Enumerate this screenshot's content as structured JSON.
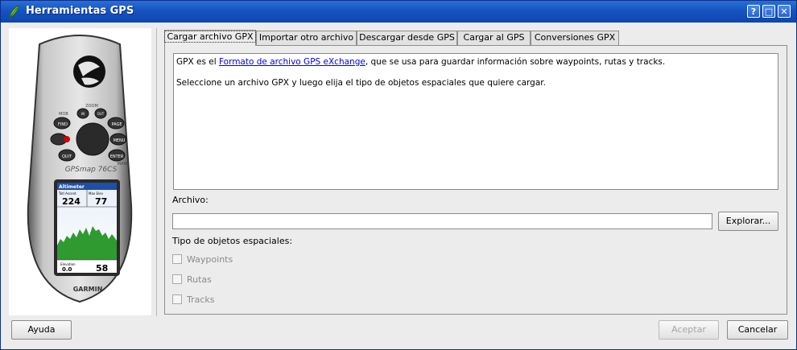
{
  "window": {
    "title": "Herramientas GPS",
    "help_btn": "?",
    "max_btn": "□",
    "close_btn": "✕"
  },
  "device_image": {
    "brand": "GARMIN",
    "model": "GPSmap 76CS",
    "screen_title": "Altimeter",
    "field1_label": "Totl Ascent",
    "field1_value": "224",
    "field2_label": "Max Elev",
    "field2_value": "77",
    "field3_label": "Elevation",
    "field3_value": "0.0",
    "field4_value": "58",
    "key_find": "FIND",
    "key_page": "PAGE",
    "key_menu": "MENU",
    "key_quit": "QUIT",
    "key_enter": "ENTER",
    "key_in": "IN",
    "key_out": "OUT",
    "label_zoom": "ZOOM",
    "label_mob": "MOB",
    "label_mark": "MARK"
  },
  "tabs": [
    {
      "label": "Cargar archivo GPX",
      "active": true
    },
    {
      "label": "Importar otro archivo",
      "active": false
    },
    {
      "label": "Descargar desde GPS",
      "active": false
    },
    {
      "label": "Cargar al GPS",
      "active": false
    },
    {
      "label": "Conversiones GPX",
      "active": false
    }
  ],
  "description": {
    "line1_pre": "GPX es el ",
    "line1_link": "Formato de archivo GPS eXchange",
    "line1_post": ", que se usa para guardar información sobre waypoints, rutas y tracks.",
    "line2": "Seleccione un archivo GPX y luego elija el tipo de objetos espaciales que quiere cargar."
  },
  "file": {
    "label": "Archivo:",
    "value": "",
    "browse_label": "Explorar..."
  },
  "feature_types": {
    "label": "Tipo de objetos espaciales:",
    "options": [
      {
        "label": "Waypoints",
        "checked": false
      },
      {
        "label": "Rutas",
        "checked": false
      },
      {
        "label": "Tracks",
        "checked": false
      }
    ]
  },
  "footer": {
    "help_label": "Ayuda",
    "accept_label": "Aceptar",
    "cancel_label": "Cancelar"
  }
}
